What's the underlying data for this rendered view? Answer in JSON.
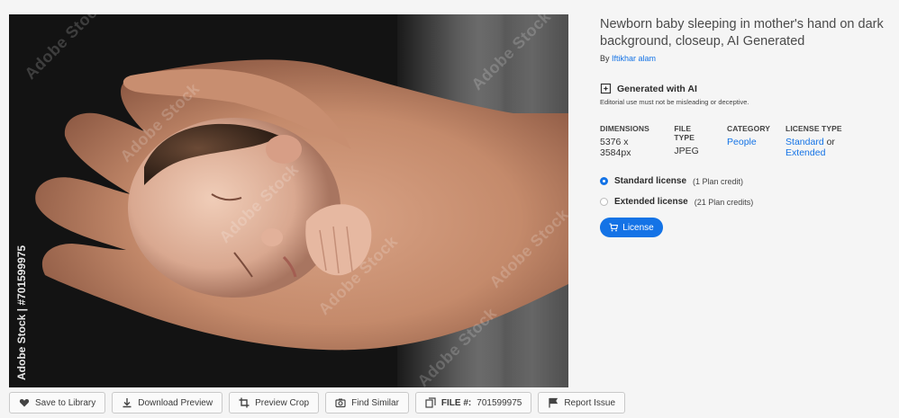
{
  "preview": {
    "watermark_text": "Adobe Stock",
    "vertical_credit": "Adobe Stock | #701599975"
  },
  "actions": {
    "save": "Save to Library",
    "download": "Download Preview",
    "crop": "Preview Crop",
    "similar": "Find Similar",
    "file_label": "FILE #:",
    "file_number": "701599975",
    "report": "Report Issue"
  },
  "info": {
    "title": "Newborn baby sleeping in mother's hand on dark background, closeup, AI Generated",
    "by_prefix": "By",
    "author": "Iftikhar alam",
    "ai_label": "Generated with AI",
    "ai_note": "Editorial use must not be misleading or deceptive.",
    "meta": {
      "dimensions_label": "DIMENSIONS",
      "dimensions_value": "5376 x 3584px",
      "filetype_label": "FILE TYPE",
      "filetype_value": "JPEG",
      "category_label": "CATEGORY",
      "category_value": "People",
      "licensetype_label": "LICENSE TYPE",
      "licensetype_standard": "Standard",
      "licensetype_or": "or",
      "licensetype_extended": "Extended"
    },
    "licenses": {
      "standard_name": "Standard license",
      "standard_credit": "(1 Plan credit)",
      "extended_name": "Extended license",
      "extended_credit": "(21 Plan credits)"
    },
    "license_button": "License"
  },
  "colors": {
    "accent": "#1473e6",
    "background": "#f5f5f5"
  }
}
